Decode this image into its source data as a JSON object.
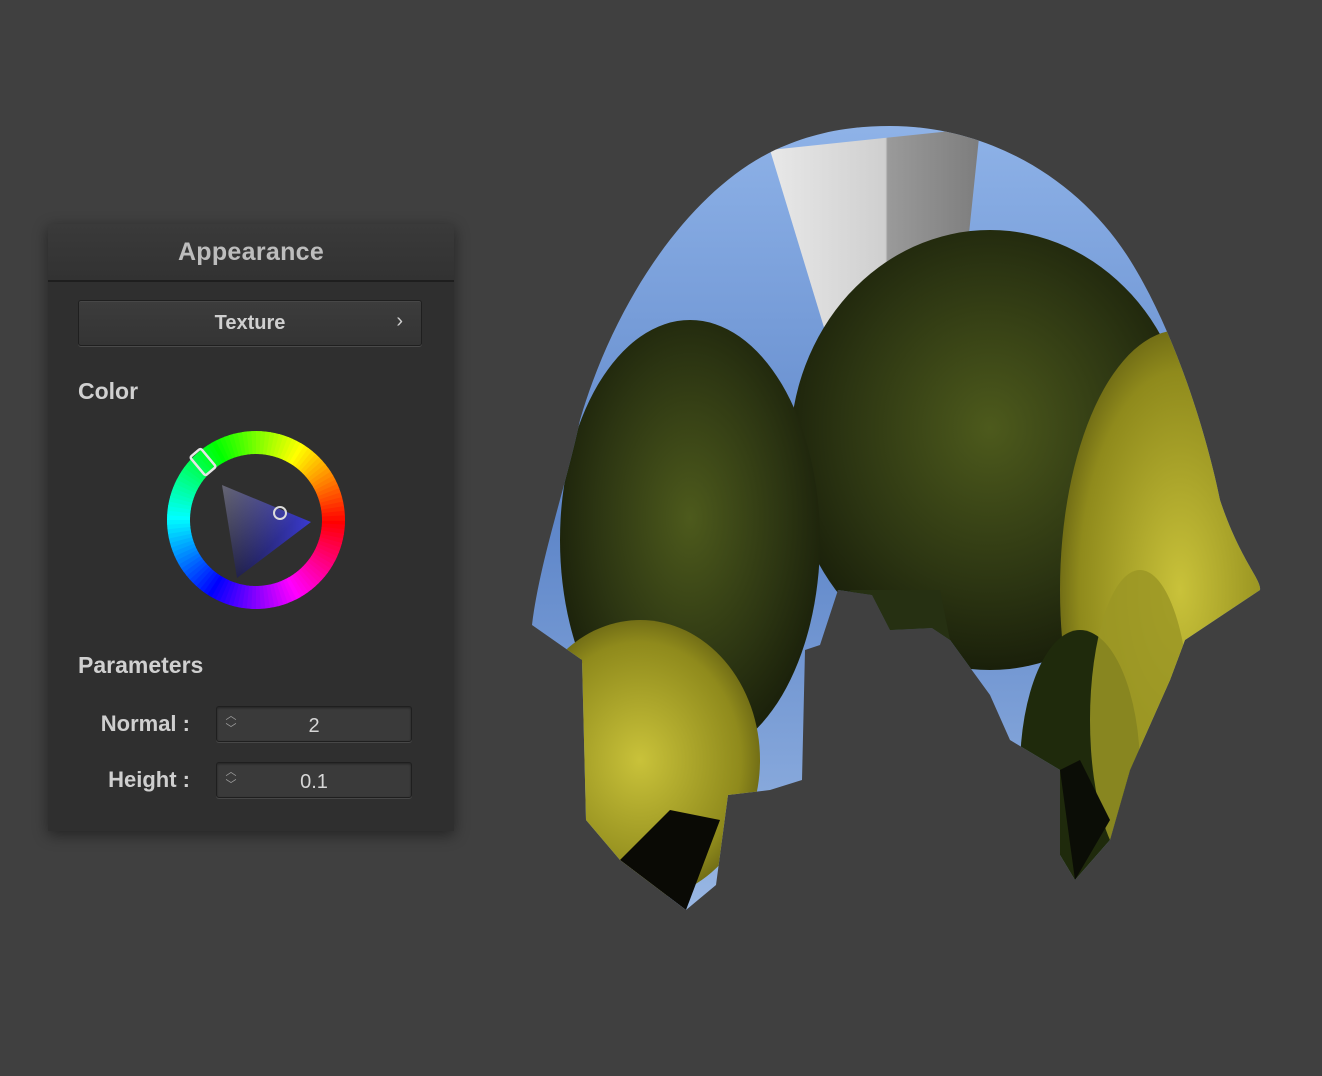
{
  "panel": {
    "title": "Appearance",
    "texture_button": {
      "label": "Texture",
      "chevron": "›"
    },
    "color_section": {
      "label": "Color"
    },
    "parameters_section": {
      "label": "Parameters",
      "fields": [
        {
          "label": "Normal :",
          "value": "2"
        },
        {
          "label": "Height :",
          "value": "0.1"
        }
      ]
    }
  },
  "colors": {
    "background": "#404040",
    "panel": "#2f2f2f",
    "selected_hue": "#3a3ad0"
  },
  "icons": [
    "chevron-right-icon",
    "spin-up-icon",
    "spin-down-icon"
  ]
}
